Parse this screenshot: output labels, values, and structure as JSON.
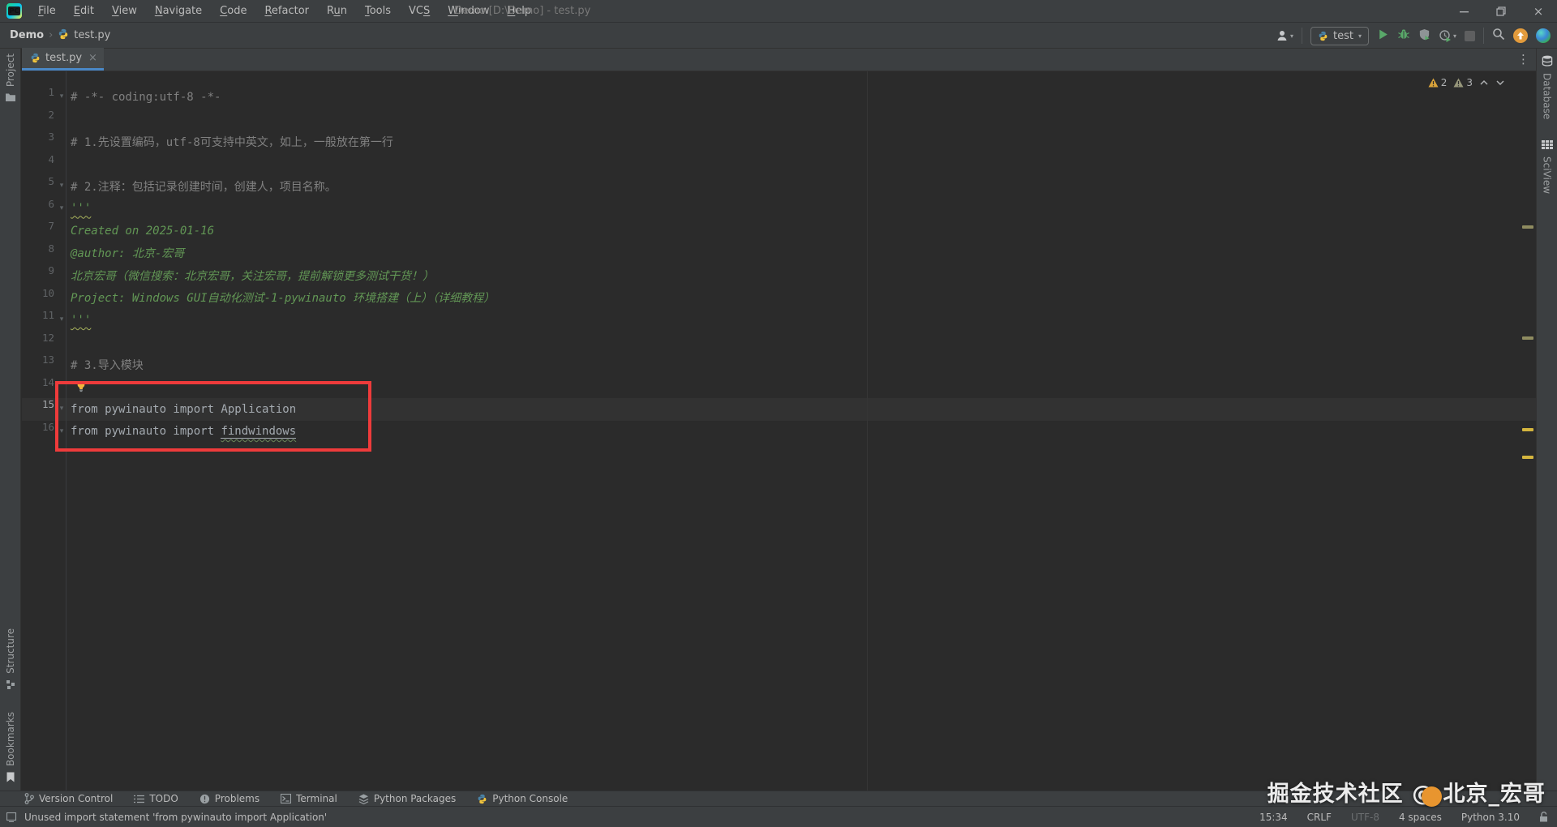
{
  "window": {
    "title": "Demo [D:\\Demo] - test.py"
  },
  "menu": {
    "items": [
      {
        "label": "File",
        "mi": 0
      },
      {
        "label": "Edit",
        "mi": 0
      },
      {
        "label": "View",
        "mi": 0
      },
      {
        "label": "Navigate",
        "mi": 0
      },
      {
        "label": "Code",
        "mi": 0
      },
      {
        "label": "Refactor",
        "mi": 0
      },
      {
        "label": "Run",
        "mi": 1
      },
      {
        "label": "Tools",
        "mi": 0
      },
      {
        "label": "VCS",
        "mi": 2
      },
      {
        "label": "Window",
        "mi": 0
      },
      {
        "label": "Help",
        "mi": 0
      }
    ]
  },
  "navbar": {
    "project": "Demo",
    "file": "test.py",
    "run_config": "test"
  },
  "tab": {
    "label": "test.py",
    "close": "×",
    "more": "⋮"
  },
  "left_stripe": {
    "project": "Project",
    "structure": "Structure",
    "bookmarks": "Bookmarks"
  },
  "right_stripe": {
    "database": "Database",
    "sciview": "SciView"
  },
  "editor": {
    "inspections": {
      "warnings": "2",
      "weak_warnings": "3"
    },
    "red_box_lines": "14-16",
    "lines": [
      {
        "num": 1,
        "text": "# -*- coding:utf-8 -*-",
        "type": "comment",
        "fold": true
      },
      {
        "num": 2,
        "text": "",
        "type": "plain"
      },
      {
        "num": 3,
        "text": "# 1.先设置编码，utf-8可支持中英文，如上，一般放在第一行",
        "type": "comment"
      },
      {
        "num": 4,
        "text": "",
        "type": "plain"
      },
      {
        "num": 5,
        "text": "# 2.注释：包括记录创建时间，创建人，项目名称。",
        "type": "comment",
        "fold": true
      },
      {
        "num": 6,
        "text": "'''",
        "type": "docstring",
        "squiggle": true,
        "fold": true
      },
      {
        "num": 7,
        "text": "Created on 2025-01-16",
        "type": "docstring"
      },
      {
        "num": 8,
        "text": "@author: 北京-宏哥",
        "type": "docstring"
      },
      {
        "num": 9,
        "text": "北京宏哥（微信搜索：北京宏哥，关注宏哥，提前解锁更多测试干货！）",
        "type": "docstring"
      },
      {
        "num": 10,
        "text": "Project: Windows GUI自动化测试-1-pywinauto 环境搭建（上）（详细教程）",
        "type": "docstring"
      },
      {
        "num": 11,
        "text": "'''",
        "type": "docstring",
        "squiggle": true,
        "fold": true
      },
      {
        "num": 12,
        "text": "",
        "type": "plain"
      },
      {
        "num": 13,
        "text": "# 3.导入模块",
        "type": "comment"
      },
      {
        "num": 14,
        "text": "",
        "type": "plain",
        "bulb": true
      },
      {
        "num": 15,
        "text": "from pywinauto import Application",
        "type": "unused",
        "fold": true,
        "current": true
      },
      {
        "num": 16,
        "text": "from pywinauto import findwindows",
        "type": "unused",
        "fold": true,
        "link_word": "findwindows"
      }
    ],
    "scroll_marks": [
      {
        "pos": 190,
        "level": "weak"
      },
      {
        "pos": 327,
        "level": "weak"
      },
      {
        "pos": 440,
        "level": "warning"
      },
      {
        "pos": 474,
        "level": "warning"
      }
    ]
  },
  "bottom_toolbar": {
    "items": [
      {
        "label": "Version Control"
      },
      {
        "label": "TODO"
      },
      {
        "label": "Problems"
      },
      {
        "label": "Terminal"
      },
      {
        "label": "Python Packages"
      },
      {
        "label": "Python Console"
      }
    ]
  },
  "status_bar": {
    "message": "Unused import statement 'from pywinauto import Application'",
    "caret": "15:34",
    "line_ending": "CRLF",
    "encoding": "UTF-8",
    "indent": "4 spaces",
    "interpreter": "Python 3.10"
  },
  "watermark": {
    "text": "掘金技术社区 @ 北京_宏哥"
  },
  "colors": {
    "accent_blue": "#4a88c7",
    "run_green": "#59a869",
    "warning_yellow": "#d4b53e",
    "annotation_red": "#ee3b3b"
  }
}
